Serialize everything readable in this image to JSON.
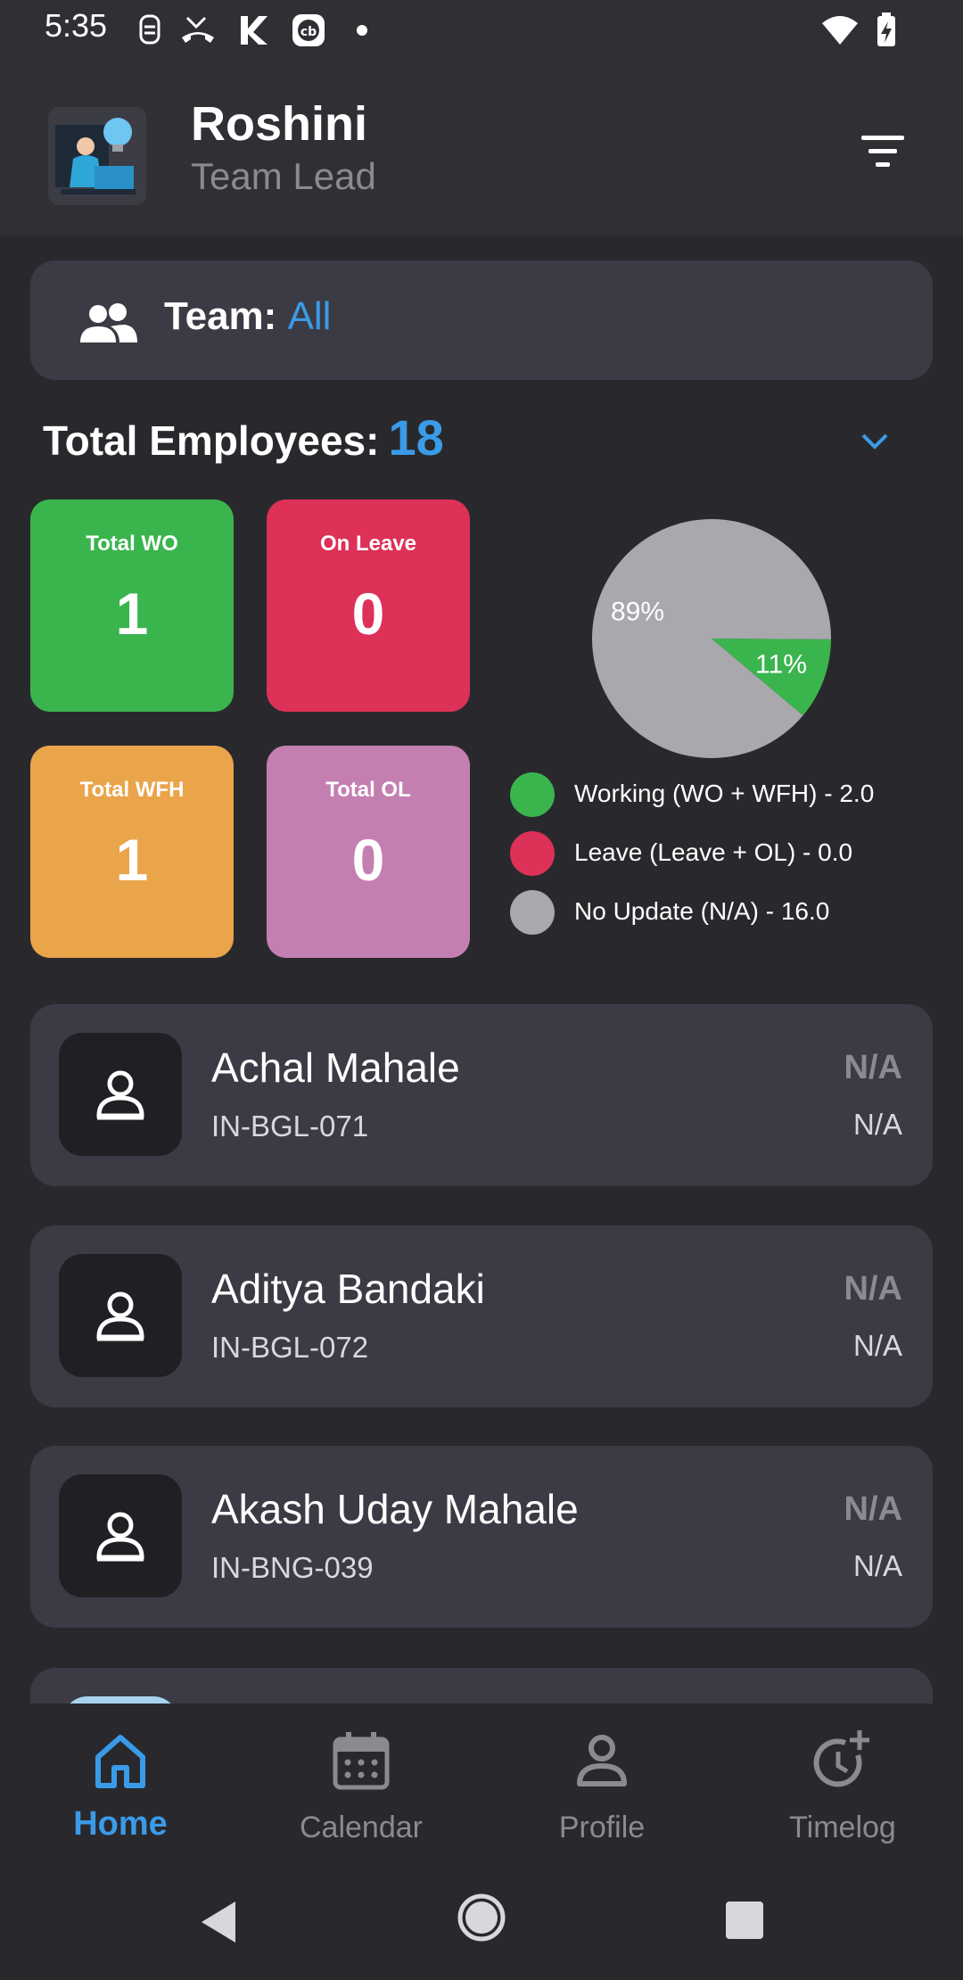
{
  "status_bar": {
    "time": "5:35",
    "icons": [
      "notification-icon",
      "missed-call-icon",
      "app-k-icon",
      "cb-app-icon",
      "dot-icon",
      "wifi-icon",
      "battery-charging-icon"
    ]
  },
  "header": {
    "name": "Roshini",
    "role": "Team Lead",
    "filter_icon": "filter-icon"
  },
  "team": {
    "label": "Team:",
    "value": "All"
  },
  "total": {
    "label": "Total Employees:",
    "value": "18"
  },
  "stats": [
    {
      "label": "Total WO",
      "value": "1",
      "color": "#3ab54e"
    },
    {
      "label": "On Leave",
      "value": "0",
      "color": "#dd3158"
    },
    {
      "label": "Total WFH",
      "value": "1",
      "color": "#eaa44a"
    },
    {
      "label": "Total OL",
      "value": "0",
      "color": "#c47fb1"
    }
  ],
  "chart_data": {
    "type": "pie",
    "slices": [
      {
        "label": "89%",
        "value": 89,
        "color": "#a8a8ad"
      },
      {
        "label": "11%",
        "value": 11,
        "color": "#3ab54e"
      }
    ],
    "legend": [
      {
        "text": "Working (WO + WFH) - 2.0",
        "color": "#3ab54e"
      },
      {
        "text": "Leave (Leave + OL) - 0.0",
        "color": "#dd3158"
      },
      {
        "text": "No Update (N/A) - 16.0",
        "color": "#a8a8ad"
      }
    ]
  },
  "employees": [
    {
      "name": "Achal Mahale",
      "id": "IN-BGL-071",
      "status1": "N/A",
      "status2": "N/A"
    },
    {
      "name": "Aditya Bandaki",
      "id": "IN-BGL-072",
      "status1": "N/A",
      "status2": "N/A"
    },
    {
      "name": "Akash Uday Mahale",
      "id": "IN-BNG-039",
      "status1": "N/A",
      "status2": "N/A"
    }
  ],
  "nav": {
    "items": [
      {
        "label": "Home",
        "icon": "home-icon",
        "active": true
      },
      {
        "label": "Calendar",
        "icon": "calendar-icon",
        "active": false
      },
      {
        "label": "Profile",
        "icon": "profile-icon",
        "active": false
      },
      {
        "label": "Timelog",
        "icon": "timelog-icon",
        "active": false
      }
    ]
  },
  "colors": {
    "accent": "#3a9be8",
    "card": "#3b3b45",
    "background": "#29292d"
  }
}
